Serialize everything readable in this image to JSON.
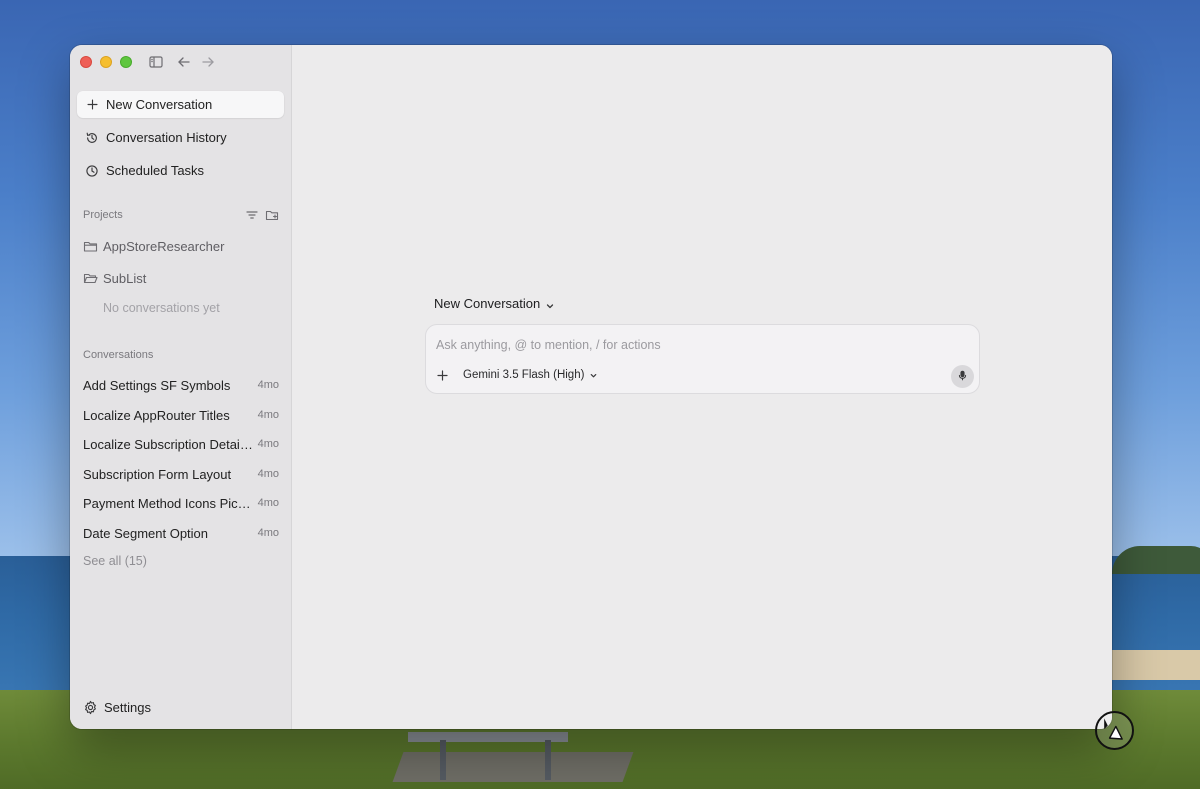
{
  "sidebar": {
    "nav": [
      {
        "label": "New Conversation",
        "icon": "plus-icon"
      },
      {
        "label": "Conversation History",
        "icon": "history-icon"
      },
      {
        "label": "Scheduled Tasks",
        "icon": "clock-icon"
      }
    ],
    "projects": {
      "label": "Projects",
      "items": [
        {
          "label": "AppStoreResearcher",
          "icon": "folder-icon"
        },
        {
          "label": "SubList",
          "icon": "folder-open-icon"
        }
      ],
      "empty_note": "No conversations yet"
    },
    "conversations": {
      "label": "Conversations",
      "items": [
        {
          "title": "Add Settings SF Symbols",
          "time": "4mo"
        },
        {
          "title": "Localize AppRouter Titles",
          "time": "4mo"
        },
        {
          "title": "Localize Subscription Detail ...",
          "time": "4mo"
        },
        {
          "title": "Subscription Form Layout",
          "time": "4mo"
        },
        {
          "title": "Payment Method Icons Picker",
          "time": "4mo"
        },
        {
          "title": "Date Segment Option",
          "time": "4mo"
        }
      ],
      "see_all": "See all (15)"
    },
    "settings_label": "Settings"
  },
  "main": {
    "conversation_selector": "New Conversation",
    "composer": {
      "placeholder": "Ask anything, @ to mention, / for actions",
      "model": "Gemini 3.5 Flash (High)"
    }
  },
  "colors": {
    "window_bg": "#ecebec",
    "sidebar_bg": "#e4e3e5",
    "traffic_red": "#ee5f57",
    "traffic_yellow": "#f5be2f",
    "traffic_green": "#5fc63f"
  }
}
